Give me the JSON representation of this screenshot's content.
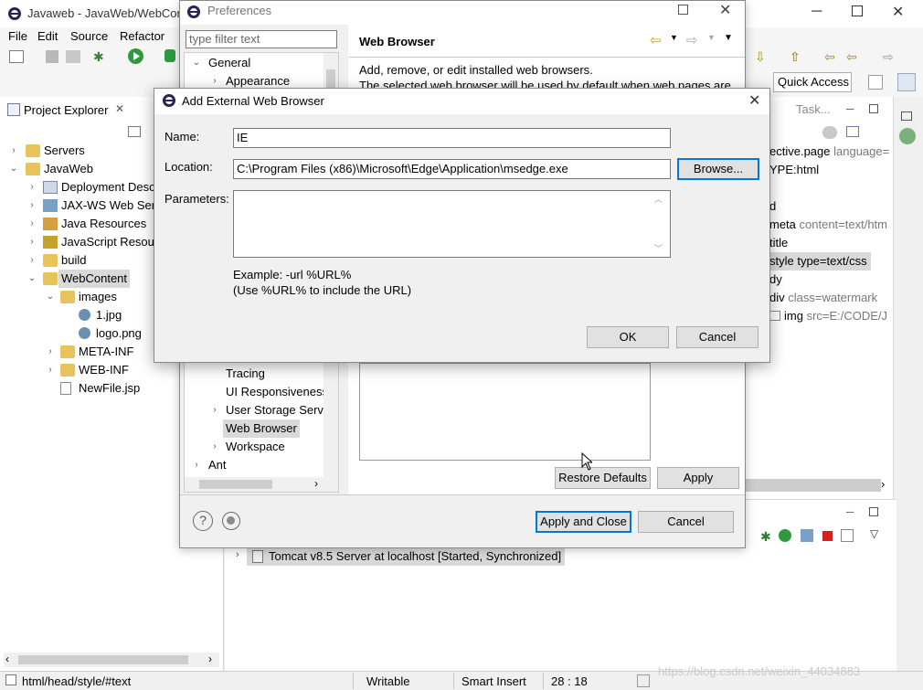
{
  "main_window": {
    "title": "Javaweb - JavaWeb/WebCon",
    "menu": [
      "File",
      "Edit",
      "Source",
      "Refactor"
    ],
    "quick_access": "Quick Access"
  },
  "project_explorer": {
    "title": "Project Explorer",
    "close_glyph": "✕",
    "tree": [
      {
        "label": "Servers",
        "icon": "folder-icon"
      },
      {
        "label": "JavaWeb",
        "icon": "project-icon"
      },
      {
        "label": "Deployment Desc",
        "icon": "deployment-descriptor-icon"
      },
      {
        "label": "JAX-WS Web Serv",
        "icon": "web-services-icon"
      },
      {
        "label": "Java Resources",
        "icon": "java-resources-icon"
      },
      {
        "label": "JavaScript Resour",
        "icon": "javascript-resources-icon"
      },
      {
        "label": "build",
        "icon": "folder-icon"
      },
      {
        "label": "WebContent",
        "icon": "folder-icon"
      },
      {
        "label": "images",
        "icon": "folder-icon"
      },
      {
        "label": "1.jpg",
        "icon": "image-file-icon"
      },
      {
        "label": "logo.png",
        "icon": "image-file-icon"
      },
      {
        "label": "META-INF",
        "icon": "folder-icon"
      },
      {
        "label": "WEB-INF",
        "icon": "folder-icon"
      },
      {
        "label": "NewFile.jsp",
        "icon": "jsp-file-icon"
      }
    ]
  },
  "editor": {
    "tab_label": "Task...",
    "lines": [
      {
        "kw": "ective.page",
        "attr": " language="
      },
      {
        "kw": "YPE:html",
        "attr": ""
      },
      {
        "kw": "d",
        "attr": ""
      },
      {
        "kw": "meta",
        "attr": " content=text/htm"
      },
      {
        "kw": "title",
        "attr": ""
      },
      {
        "kw": "style type=text/css",
        "attr": ""
      },
      {
        "kw": "dy",
        "attr": ""
      },
      {
        "kw": "div",
        "attr": " class=watermark"
      },
      {
        "kw": "img",
        "attr": " src=E:/CODE/J"
      }
    ]
  },
  "servers": {
    "row": "Tomcat v8.5 Server at localhost  [Started, Synchronized]"
  },
  "statusbar": {
    "path": "html/head/style/#text",
    "writable": "Writable",
    "insert_mode": "Smart Insert",
    "position": "28 : 18",
    "watermark": "https://blog.csdn.net/weixin_44034883"
  },
  "preferences": {
    "title": "Preferences",
    "filter_placeholder": "type filter text",
    "page_title": "Web Browser",
    "description_1": "Add, remove, or edit installed web browsers.",
    "description_2": "The selected web browser will be used by default when web pages are",
    "tree_top": [
      {
        "label": "General",
        "expanded": true
      },
      {
        "label": "Appearance",
        "expanded": false
      }
    ],
    "tree_bottom": [
      {
        "label": "Tracing"
      },
      {
        "label": "UI Responsiveness"
      },
      {
        "label": "User Storage Serv"
      },
      {
        "label": "Web Browser"
      },
      {
        "label": "Workspace"
      },
      {
        "label": "Ant"
      }
    ],
    "restore_defaults": "Restore Defaults",
    "apply": "Apply",
    "apply_and_close": "Apply and Close",
    "cancel": "Cancel"
  },
  "add_browser": {
    "title": "Add External Web Browser",
    "name_label": "Name:",
    "name_value": "IE",
    "location_label": "Location:",
    "location_value": "C:\\Program Files (x86)\\Microsoft\\Edge\\Application\\msedge.exe",
    "browse": "Browse...",
    "parameters_label": "Parameters:",
    "parameters_value": "",
    "example_1": "Example: -url %URL%",
    "example_2": "(Use %URL% to include the URL)",
    "ok": "OK",
    "cancel": "Cancel"
  }
}
